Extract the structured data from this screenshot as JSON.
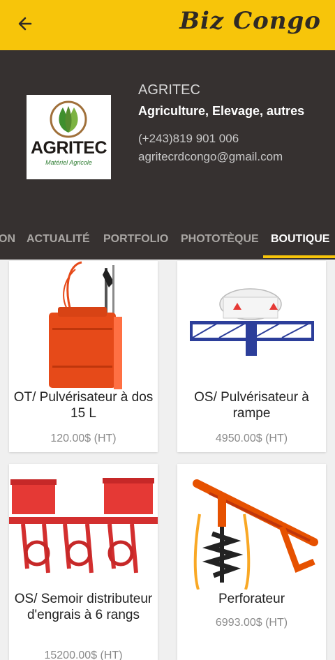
{
  "topbar": {
    "back_icon": "arrow-left-icon",
    "brand": "Biz Congo"
  },
  "profile": {
    "logo_name": "AGRITEC",
    "logo_sub": "Matériel Agricole",
    "company": "AGRITEC",
    "category": "Agriculture, Elevage, autres",
    "phone": "(+243)819 901 006",
    "email": "agritecrdcongo@gmail.com"
  },
  "tabs": [
    {
      "label": "ON"
    },
    {
      "label": "ACTUALITÉ"
    },
    {
      "label": "PORTFOLIO"
    },
    {
      "label": "PHOTOTÈQUE"
    },
    {
      "label": "BOUTIQUE",
      "active": true
    }
  ],
  "products": [
    {
      "title": "OT/ Pulvérisateur à dos 15 L",
      "price": "120.00$ (HT)"
    },
    {
      "title": "OS/ Pulvérisateur à rampe",
      "price": "4950.00$ (HT)"
    },
    {
      "title": "OS/ Semoir distributeur d'engrais à 6 rangs",
      "price": "15200.00$ (HT)"
    },
    {
      "title": "Perforateur",
      "price": "6993.00$ (HT)"
    }
  ],
  "colors": {
    "accent": "#f7c50a",
    "header_bg": "#363130"
  }
}
